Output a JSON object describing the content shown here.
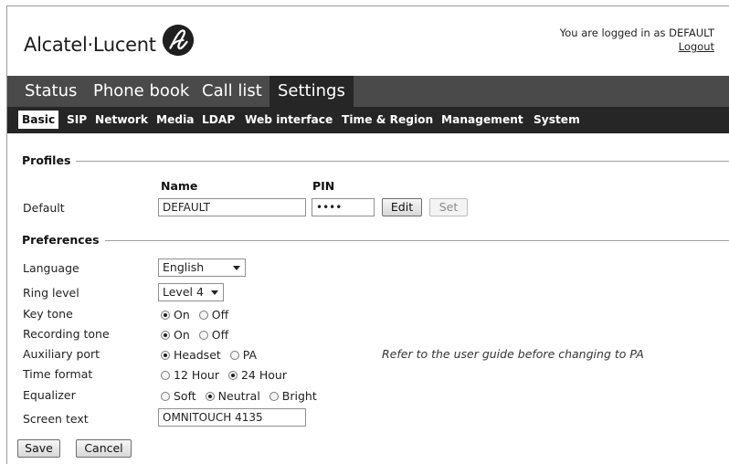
{
  "header": {
    "brand": "Alcatel·Lucent",
    "login_text": "You are logged in as DEFAULT",
    "logout_label": "Logout"
  },
  "main_nav": [
    {
      "label": "Status",
      "active": false
    },
    {
      "label": "Phone book",
      "active": false
    },
    {
      "label": "Call list",
      "active": false
    },
    {
      "label": "Settings",
      "active": true
    }
  ],
  "sub_nav": [
    {
      "label": "Basic",
      "active": true
    },
    {
      "label": "SIP",
      "active": false
    },
    {
      "label": "Network",
      "active": false
    },
    {
      "label": "Media",
      "active": false
    },
    {
      "label": "LDAP",
      "active": false
    },
    {
      "label": "Web interface",
      "active": false
    },
    {
      "label": "Time & Region",
      "active": false
    },
    {
      "label": "Management",
      "active": false
    },
    {
      "label": "System",
      "active": false
    }
  ],
  "profiles": {
    "section_title": "Profiles",
    "name_header": "Name",
    "pin_header": "PIN",
    "row_label": "Default",
    "name_value": "DEFAULT",
    "pin_value": "••••",
    "edit_label": "Edit",
    "set_label": "Set"
  },
  "preferences": {
    "section_title": "Preferences",
    "language": {
      "label": "Language",
      "value": "English"
    },
    "ring_level": {
      "label": "Ring level",
      "value": "Level 4"
    },
    "key_tone": {
      "label": "Key tone",
      "options": [
        "On",
        "Off"
      ],
      "selected": "On"
    },
    "recording_tone": {
      "label": "Recording tone",
      "options": [
        "On",
        "Off"
      ],
      "selected": "On"
    },
    "auxiliary_port": {
      "label": "Auxiliary port",
      "options": [
        "Headset",
        "PA"
      ],
      "selected": "Headset",
      "hint": "Refer to the user guide before changing to PA"
    },
    "time_format": {
      "label": "Time format",
      "options": [
        "12 Hour",
        "24 Hour"
      ],
      "selected": "24 Hour"
    },
    "equalizer": {
      "label": "Equalizer",
      "options": [
        "Soft",
        "Neutral",
        "Bright"
      ],
      "selected": "Neutral"
    },
    "screen_text": {
      "label": "Screen text",
      "value": "OMNITOUCH 4135"
    }
  },
  "actions": {
    "save_label": "Save",
    "cancel_label": "Cancel"
  },
  "colors": {
    "main_nav_bg": "#4a4a4a",
    "main_nav_active_bg": "#262626",
    "sub_nav_bg": "#262626"
  },
  "icons": {
    "brand_logo": "alcatel-lucent-swirl-icon"
  }
}
